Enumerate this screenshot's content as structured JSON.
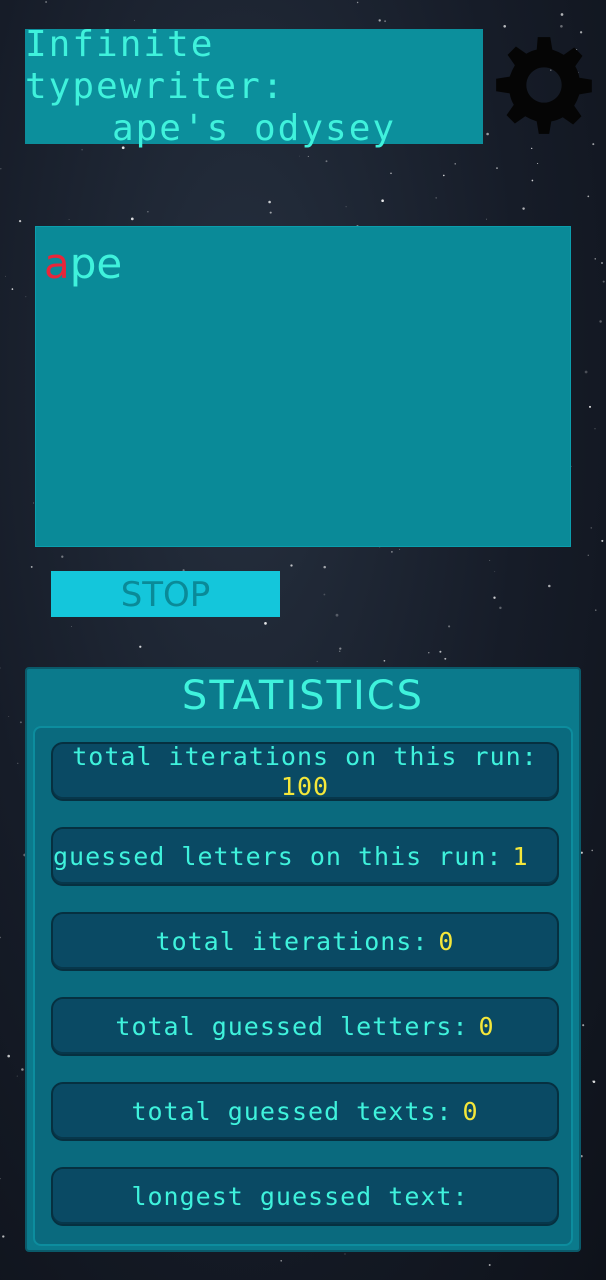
{
  "header": {
    "title_line1": "Infinite typewriter:",
    "title_line2": "ape's odysey"
  },
  "icons": {
    "settings": "gear-icon"
  },
  "typewriter": {
    "guessed_part": "a",
    "remaining_part": "pe"
  },
  "controls": {
    "stop_label": "STOP"
  },
  "statistics": {
    "title": "STATISTICS",
    "items": [
      {
        "label": "total iterations on this run:",
        "value": "100"
      },
      {
        "label": "guessed letters on this run:",
        "value": "1"
      },
      {
        "label": "total iterations:",
        "value": "0"
      },
      {
        "label": "total guessed letters:",
        "value": "0"
      },
      {
        "label": "total guessed texts:",
        "value": "0"
      },
      {
        "label": "longest guessed text:",
        "value": ""
      }
    ]
  },
  "colors": {
    "panel": "#0c8f9c",
    "text_accent": "#3ff2dc",
    "value_yellow": "#f4e73a",
    "guessed_red": "#e8263a",
    "stop_button": "#14c6db"
  }
}
